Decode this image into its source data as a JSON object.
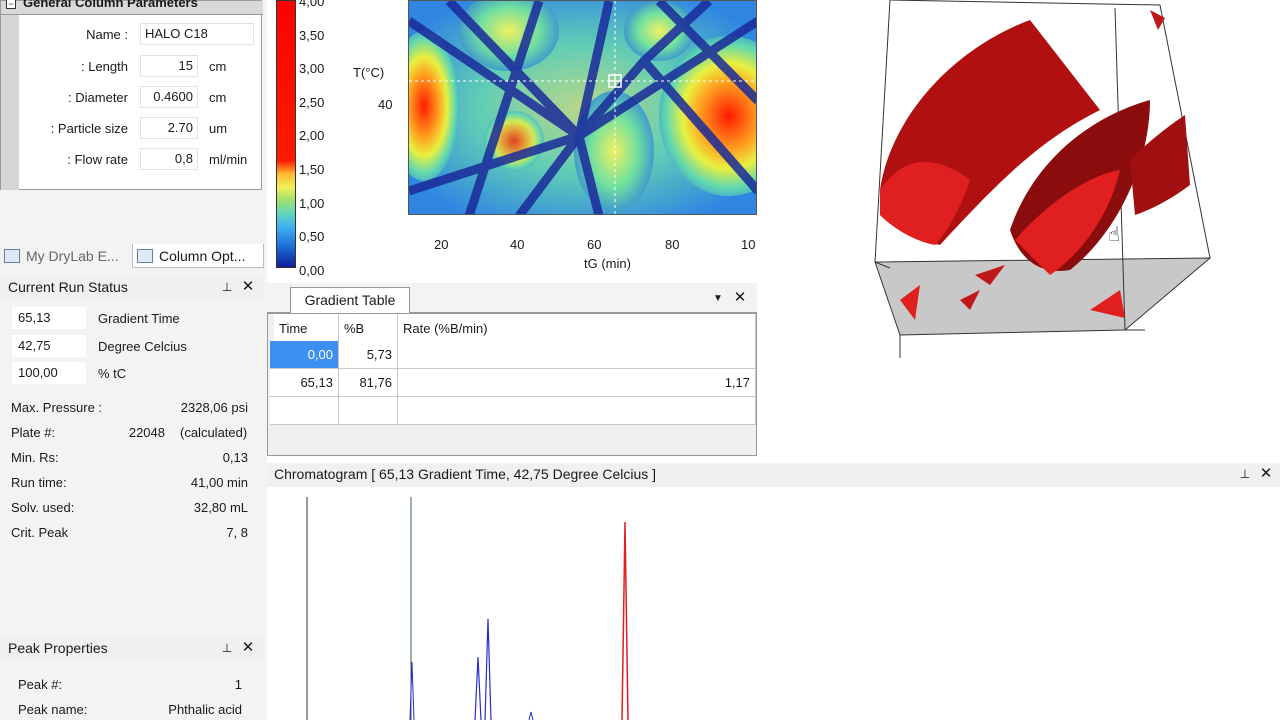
{
  "column_params": {
    "header": "General Column Parameters",
    "fields": [
      {
        "label": "Name :",
        "value": "HALO C18",
        "unit": ""
      },
      {
        "label": ": Length",
        "value": "15",
        "unit": "cm"
      },
      {
        "label": ": Diameter",
        "value": "0.4600",
        "unit": "cm"
      },
      {
        "label": ": Particle size",
        "value": "2.70",
        "unit": "um"
      },
      {
        "label": ": Flow rate",
        "value": "0,8",
        "unit": "ml/min"
      }
    ]
  },
  "tabs": [
    {
      "label": "My DryLab E...",
      "icon": "drylab-icon"
    },
    {
      "label": "Column Opt...",
      "icon": "column-icon"
    }
  ],
  "run_status": {
    "title": "Current Run Status",
    "rows": [
      {
        "value": "65,13",
        "label": "Gradient Time"
      },
      {
        "value": "42,75",
        "label": "Degree Celcius"
      },
      {
        "value": "100,00",
        "label": "% tC"
      }
    ],
    "stats": [
      {
        "label": "Max. Pressure :",
        "value": "2328,06 psi",
        "extra": ""
      },
      {
        "label": "Plate #:",
        "value": "22048",
        "extra": "(calculated)"
      },
      {
        "label": "Min. Rs:",
        "value": "0,13",
        "extra": ""
      },
      {
        "label": "Run time:",
        "value": "41,00 min",
        "extra": ""
      },
      {
        "label": "Solv. used:",
        "value": "32,80 mL",
        "extra": ""
      },
      {
        "label": "Crit. Peak",
        "value": "7, 8",
        "extra": ""
      }
    ]
  },
  "peak_properties": {
    "title": "Peak Properties",
    "rows": [
      {
        "label": "Peak #:",
        "value": "1"
      },
      {
        "label": "Peak name:",
        "value": "Phthalic acid"
      }
    ]
  },
  "resolution_map": {
    "colorbar_ticks": [
      "4,00",
      "3,50",
      "3,00",
      "2,50",
      "2,00",
      "1,50",
      "1,00",
      "0,50",
      "0,00"
    ],
    "y_label": "T(°C)",
    "y_ticks": [
      "40"
    ],
    "x_ticks": [
      "20",
      "40",
      "60",
      "80",
      "10"
    ],
    "x_label": "tG (min)"
  },
  "gradient_table": {
    "tab_label": "Gradient Table",
    "columns": [
      "Time",
      "%B",
      "Rate (%B/min)"
    ],
    "rows": [
      {
        "time": "0,00",
        "b": "5,73",
        "rate": ""
      },
      {
        "time": "65,13",
        "b": "81,76",
        "rate": "1,17"
      }
    ]
  },
  "chromatogram": {
    "title": "Chromatogram [ 65,13 Gradient Time, 42,75 Degree Celcius ]"
  },
  "colors": {
    "selected_cell": "#3d8ff0",
    "peak_red": "#e02020",
    "peak_blue": "#2a2ad0"
  }
}
